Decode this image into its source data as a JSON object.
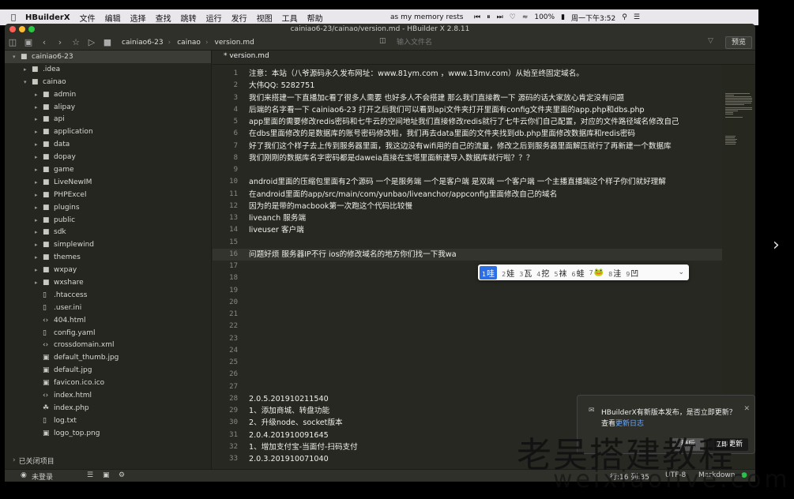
{
  "menubar": {
    "app_name": "HBuilderX",
    "items": [
      "文件",
      "编辑",
      "选择",
      "查找",
      "跳转",
      "运行",
      "发行",
      "视图",
      "工具",
      "帮助"
    ],
    "now_playing": "as my memory rests",
    "battery": "100%",
    "clock": "周一下午3:52"
  },
  "window": {
    "title": "cainiao6-23/cainao/version.md - HBuilder X 2.8.11",
    "breadcrumb": [
      "cainiao6-23",
      "cainao",
      "version.md"
    ],
    "search_placeholder": "输入文件名",
    "preview_label": "预览"
  },
  "sidebar": {
    "items": [
      {
        "label": "cainiao6-23",
        "icon": "folder",
        "depth": 0,
        "expanded": true,
        "root": true
      },
      {
        "label": ".idea",
        "icon": "folder",
        "depth": 1,
        "expanded": false
      },
      {
        "label": "cainao",
        "icon": "folder",
        "depth": 1,
        "expanded": true
      },
      {
        "label": "admin",
        "icon": "folder",
        "depth": 2,
        "expanded": false
      },
      {
        "label": "alipay",
        "icon": "folder",
        "depth": 2,
        "expanded": false
      },
      {
        "label": "api",
        "icon": "folder",
        "depth": 2,
        "expanded": false
      },
      {
        "label": "application",
        "icon": "folder",
        "depth": 2,
        "expanded": false
      },
      {
        "label": "data",
        "icon": "folder",
        "depth": 2,
        "expanded": false
      },
      {
        "label": "dopay",
        "icon": "folder",
        "depth": 2,
        "expanded": false
      },
      {
        "label": "game",
        "icon": "folder",
        "depth": 2,
        "expanded": false
      },
      {
        "label": "LiveNewIM",
        "icon": "folder",
        "depth": 2,
        "expanded": false
      },
      {
        "label": "PHPExcel",
        "icon": "folder",
        "depth": 2,
        "expanded": false
      },
      {
        "label": "plugins",
        "icon": "folder",
        "depth": 2,
        "expanded": false
      },
      {
        "label": "public",
        "icon": "folder",
        "depth": 2,
        "expanded": false
      },
      {
        "label": "sdk",
        "icon": "folder",
        "depth": 2,
        "expanded": false
      },
      {
        "label": "simplewind",
        "icon": "folder",
        "depth": 2,
        "expanded": false
      },
      {
        "label": "themes",
        "icon": "folder",
        "depth": 2,
        "expanded": false
      },
      {
        "label": "wxpay",
        "icon": "folder",
        "depth": 2,
        "expanded": false
      },
      {
        "label": "wxshare",
        "icon": "folder",
        "depth": 2,
        "expanded": false
      },
      {
        "label": ".htaccess",
        "icon": "file",
        "depth": 2
      },
      {
        "label": ".user.ini",
        "icon": "file",
        "depth": 2
      },
      {
        "label": "404.html",
        "icon": "code",
        "depth": 2
      },
      {
        "label": "config.yaml",
        "icon": "file",
        "depth": 2
      },
      {
        "label": "crossdomain.xml",
        "icon": "code",
        "depth": 2
      },
      {
        "label": "default_thumb.jpg",
        "icon": "image",
        "depth": 2
      },
      {
        "label": "default.jpg",
        "icon": "image",
        "depth": 2
      },
      {
        "label": "favicon.ico.ico",
        "icon": "image",
        "depth": 2
      },
      {
        "label": "index.html",
        "icon": "code",
        "depth": 2
      },
      {
        "label": "index.php",
        "icon": "php",
        "depth": 2
      },
      {
        "label": "log.txt",
        "icon": "file",
        "depth": 2
      },
      {
        "label": "logo_top.png",
        "icon": "image",
        "depth": 2
      }
    ],
    "closed_projects": "已关闭项目"
  },
  "editor": {
    "tab": "* version.md",
    "lines": [
      {
        "n": "1",
        "text": "注意：本站（八爷源码永久发布网址：www.81ym.com ，www.13mv.com）从始至终固定域名。"
      },
      {
        "n": "2",
        "text": "大伟QQ: 5282751"
      },
      {
        "n": "3",
        "text": "我们来搭建一下直播加c看了很多人需要   也好多人不会搭建   那么我们直接教一下   源码的话大家放心肯定没有问题"
      },
      {
        "n": "4",
        "text": "后端的名字看一下   cainiao6-23 打开之后我们可以看到api文件夹打开里面有config文件夹里面的app.php和dbs.php"
      },
      {
        "n": "5",
        "text": "app里面的需要修改redis密码和七牛云的空间地址我们直接修改redis就行了七牛云你们自己配置，对应的文件路径域名修改自己"
      },
      {
        "n": "6",
        "text": "在dbs里面修改的是数据库的账号密码修改啦，我们再去data里面的文件夹找到db.php里面修改数据库和redis密码"
      },
      {
        "n": "7",
        "text": "好了我们这个样子去上传到服务器里面，我这边没有wifi用的自己的流量，修改之后到服务器里面解压就行了再新建一个数据库"
      },
      {
        "n": "8",
        "text": "我们刚刚的数据库名字密码都是daweia直接在宝塔里面新建导入数据库就行啦？？？"
      },
      {
        "n": "9",
        "text": ""
      },
      {
        "n": "10",
        "text": "android里面的压缩包里面有2个源码   一个是服务端 一个是客户端 是双端 一个客户端   一个主播直播端这个样子你们就好理解"
      },
      {
        "n": "11",
        "text": "在android里面的app/src/main/com/yunbao/liveanchor/appconfig里面修改自己的域名"
      },
      {
        "n": "12",
        "text": "因为的是带的macbook第一次跑这个代码比较慢"
      },
      {
        "n": "13",
        "text": "liveanch 服务端"
      },
      {
        "n": "14",
        "text": "liveuser 客户端"
      },
      {
        "n": "15",
        "text": ""
      },
      {
        "n": "16",
        "text": "问题好烦   服务器IP不行   ios的修改域名的地方你们找一下我wa"
      },
      {
        "n": "17",
        "text": ""
      },
      {
        "n": "18",
        "text": ""
      },
      {
        "n": "19",
        "text": ""
      },
      {
        "n": "20",
        "text": ""
      },
      {
        "n": "21",
        "text": ""
      },
      {
        "n": "22",
        "text": ""
      },
      {
        "n": "23",
        "text": ""
      },
      {
        "n": "24",
        "text": ""
      },
      {
        "n": "25",
        "text": ""
      },
      {
        "n": "26",
        "text": ""
      },
      {
        "n": "27",
        "text": ""
      },
      {
        "n": "28",
        "text": "2.0.5.201910211540"
      },
      {
        "n": "29",
        "text": "    1、添加商城、转盘功能"
      },
      {
        "n": "30",
        "text": "    2、升级node、socket版本"
      },
      {
        "n": "31",
        "text": "2.0.4.201910091645"
      },
      {
        "n": "32",
        "text": "    1、增加支付宝-当面付-扫码支付"
      },
      {
        "n": "33",
        "text": "2.0.3.201910071040"
      }
    ],
    "active_line": "16"
  },
  "ime": {
    "candidates": [
      {
        "num": "1",
        "text": "哇"
      },
      {
        "num": "2",
        "text": "娃"
      },
      {
        "num": "3",
        "text": "瓦"
      },
      {
        "num": "4",
        "text": "挖"
      },
      {
        "num": "5",
        "text": "袜"
      },
      {
        "num": "6",
        "text": "蛙"
      },
      {
        "num": "7",
        "text": "🐸"
      },
      {
        "num": "8",
        "text": "洼"
      },
      {
        "num": "9",
        "text": "凹"
      }
    ]
  },
  "notification": {
    "message": "HBuilderX有新版本发布，是否立即更新？",
    "view_prefix": "查看",
    "link": "更新日志",
    "later": "稍后",
    "update": "立即更新"
  },
  "statusbar": {
    "login": "未登录",
    "position": "行:16  列:35",
    "encoding": "UTF-8",
    "language": "Markdown"
  },
  "watermark": {
    "text": "老吴搭建教程",
    "sub": "weixiaolive.com"
  },
  "colors": {
    "editor_bg": "#272822",
    "ime_selected": "#2c6ee5",
    "link": "#6aa9ff"
  }
}
